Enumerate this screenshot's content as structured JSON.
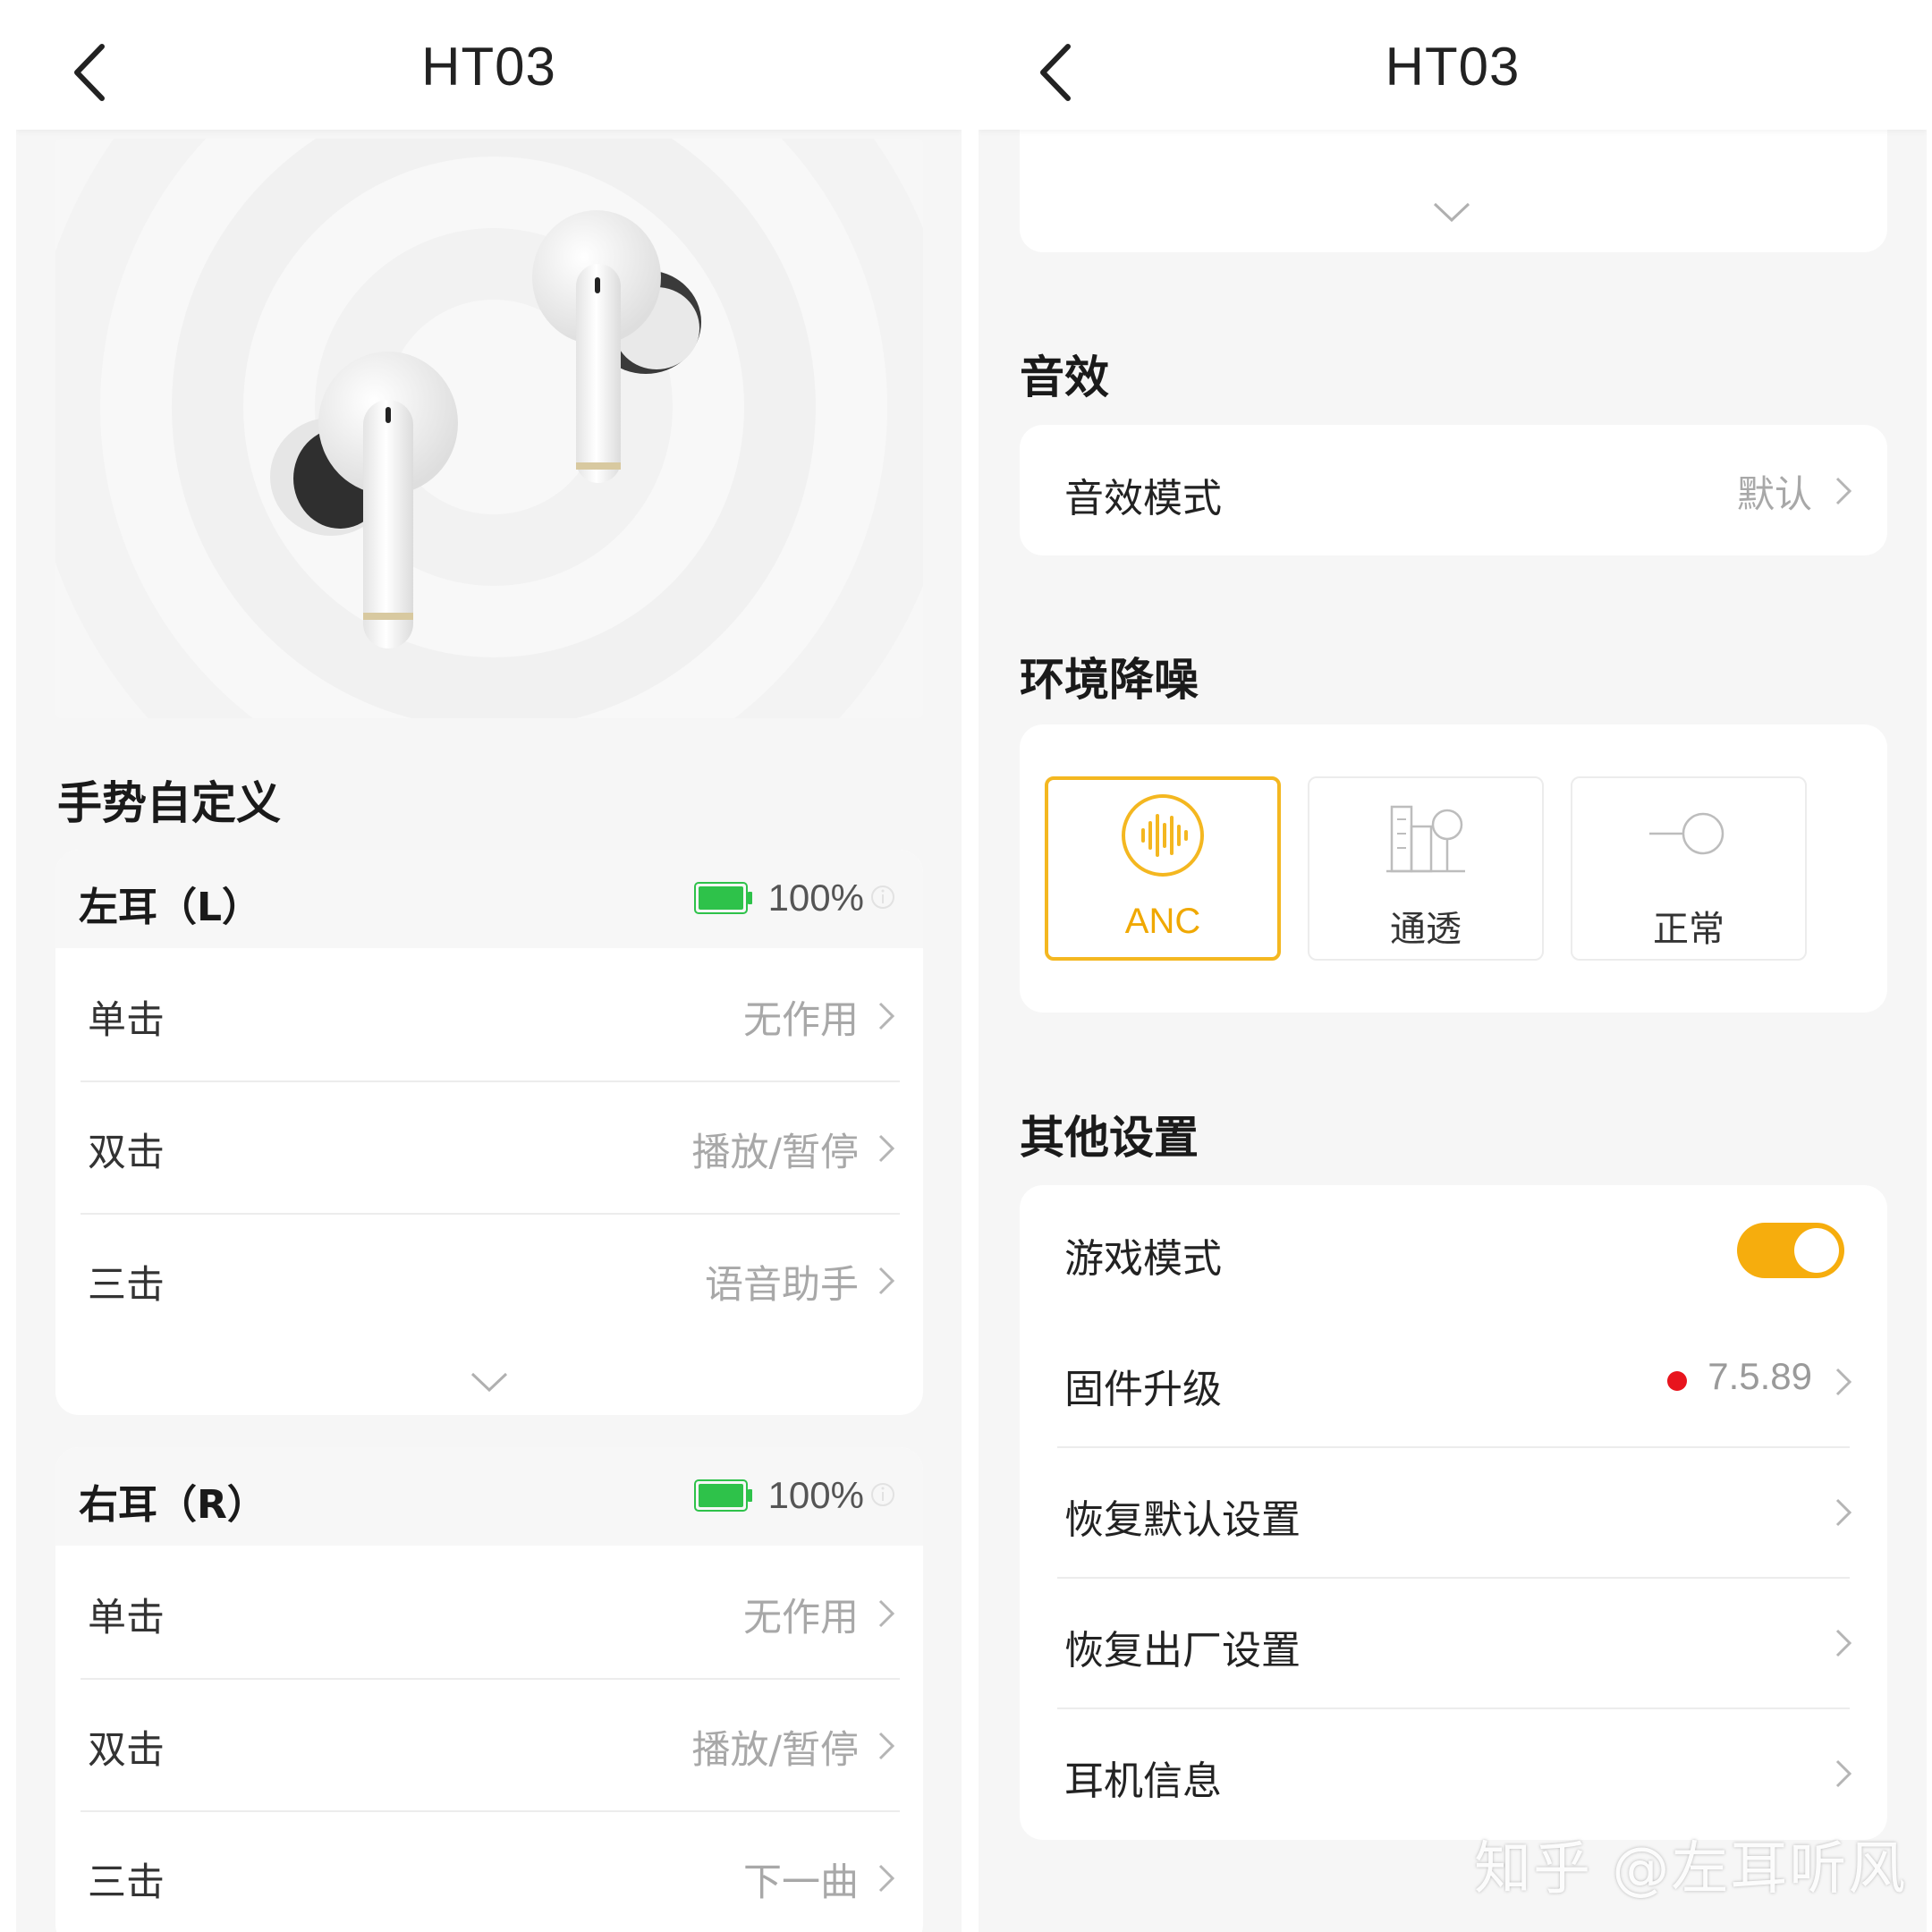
{
  "left_panel": {
    "header": {
      "title": "HT03",
      "back_icon": "chevron-left-icon"
    },
    "gesture_section_title": "手势自定义",
    "left_ear": {
      "name": "左耳（L）",
      "battery_pct": "100%",
      "battery_level": 1.0,
      "rows": [
        {
          "label": "单击",
          "value": "无作用"
        },
        {
          "label": "双击",
          "value": "播放/暂停"
        },
        {
          "label": "三击",
          "value": "语音助手"
        }
      ]
    },
    "right_ear": {
      "name": "右耳（R）",
      "battery_pct": "100%",
      "battery_level": 1.0,
      "rows": [
        {
          "label": "单击",
          "value": "无作用"
        },
        {
          "label": "双击",
          "value": "播放/暂停"
        },
        {
          "label": "三击",
          "value": "下一曲"
        }
      ]
    }
  },
  "right_panel": {
    "header": {
      "title": "HT03",
      "back_icon": "chevron-left-icon"
    },
    "sound_section_title": "音效",
    "sound_mode": {
      "label": "音效模式",
      "value": "默认"
    },
    "anc_section_title": "环境降噪",
    "anc_options": [
      {
        "label": "ANC",
        "icon": "anc-waveform-icon",
        "active": true
      },
      {
        "label": "通透",
        "icon": "building-tree-icon",
        "active": false
      },
      {
        "label": "正常",
        "icon": "line-circle-icon",
        "active": false
      }
    ],
    "other_section_title": "其他设置",
    "other": {
      "game_mode": {
        "label": "游戏模式",
        "on": true
      },
      "firmware": {
        "label": "固件升级",
        "value": "7.5.89"
      },
      "restore_default": {
        "label": "恢复默认设置"
      },
      "factory_reset": {
        "label": "恢复出厂设置"
      },
      "earphone_info": {
        "label": "耳机信息"
      }
    }
  },
  "colors": {
    "accent": "#f4b720",
    "toggle": "#f6ad0d",
    "battery": "#2ec24a",
    "update_dot": "#e8141d"
  },
  "watermark": "知乎 @左耳听风"
}
